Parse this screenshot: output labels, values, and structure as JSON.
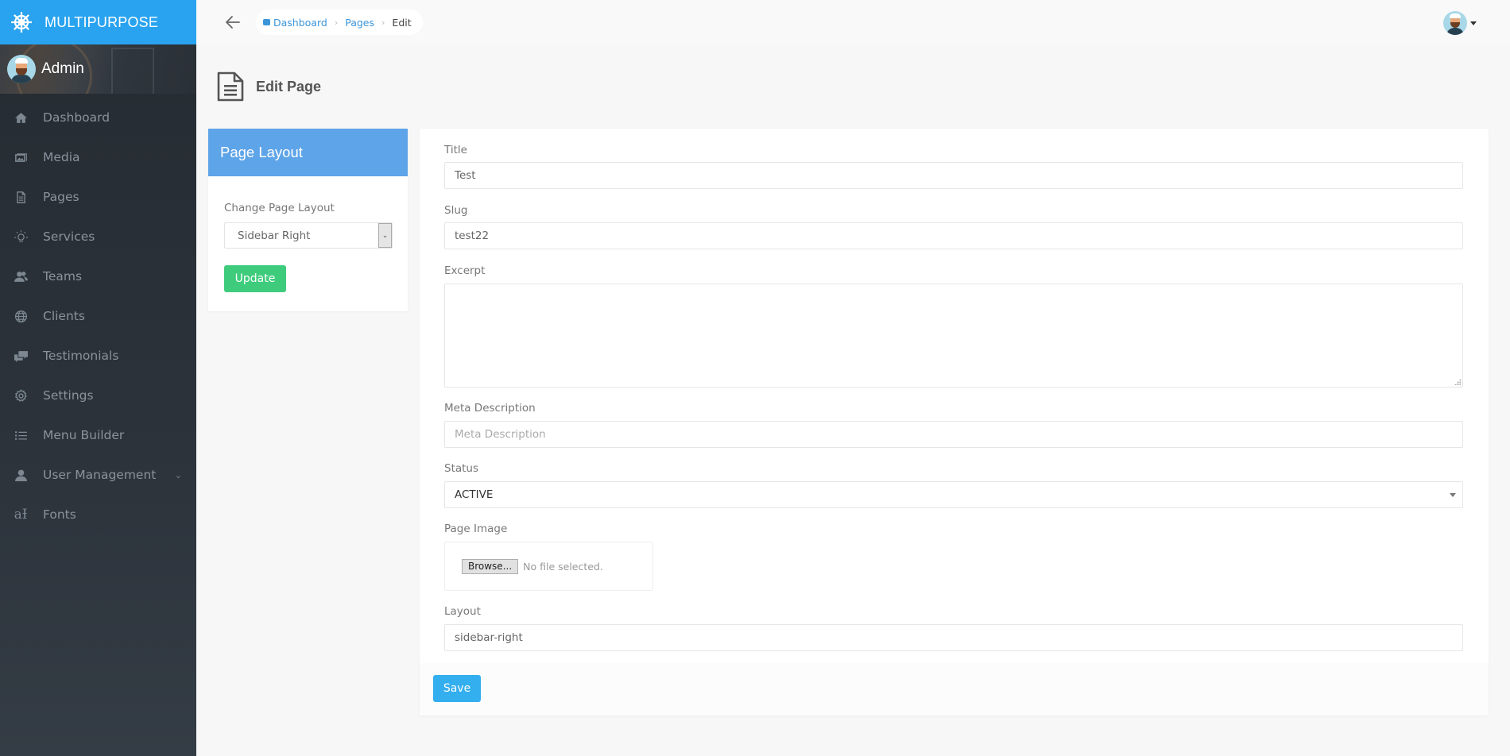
{
  "app": {
    "brand": "MULTIPURPOSE",
    "user_name": "Admin",
    "brand_color": "#29a3ef"
  },
  "sidebar": {
    "items": [
      {
        "label": "Dashboard",
        "icon": "home-icon"
      },
      {
        "label": "Media",
        "icon": "images-icon"
      },
      {
        "label": "Pages",
        "icon": "file-text-icon"
      },
      {
        "label": "Services",
        "icon": "lightbulb-icon"
      },
      {
        "label": "Teams",
        "icon": "users-icon"
      },
      {
        "label": "Clients",
        "icon": "globe-icon"
      },
      {
        "label": "Testimonials",
        "icon": "comments-icon"
      },
      {
        "label": "Settings",
        "icon": "gear-icon"
      },
      {
        "label": "Menu Builder",
        "icon": "list-icon"
      },
      {
        "label": "User Management",
        "icon": "user-icon",
        "has_submenu": true
      },
      {
        "label": "Fonts",
        "icon": "font-icon"
      }
    ]
  },
  "header": {
    "breadcrumb": [
      {
        "label": "Dashboard",
        "link": true
      },
      {
        "label": "Pages",
        "link": true
      },
      {
        "label": "Edit",
        "link": false
      }
    ]
  },
  "page": {
    "title": "Edit Page"
  },
  "layout_card": {
    "title": "Page Layout",
    "select_label": "Change Page Layout",
    "selected": "Sidebar Right",
    "update_label": "Update",
    "header_color": "#5ea4e8",
    "update_color": "#3ecc7c"
  },
  "form": {
    "title_label": "Title",
    "title_value": "Test",
    "slug_label": "Slug",
    "slug_value": "test22",
    "excerpt_label": "Excerpt",
    "excerpt_value": "",
    "meta_label": "Meta Description",
    "meta_value": "",
    "meta_placeholder": "Meta Description",
    "status_label": "Status",
    "status_value": "ACTIVE",
    "image_label": "Page Image",
    "browse_label": "Browse...",
    "no_file": "No file selected.",
    "layout_label": "Layout",
    "layout_value": "sidebar-right",
    "save_label": "Save",
    "save_color": "#33aeee"
  }
}
